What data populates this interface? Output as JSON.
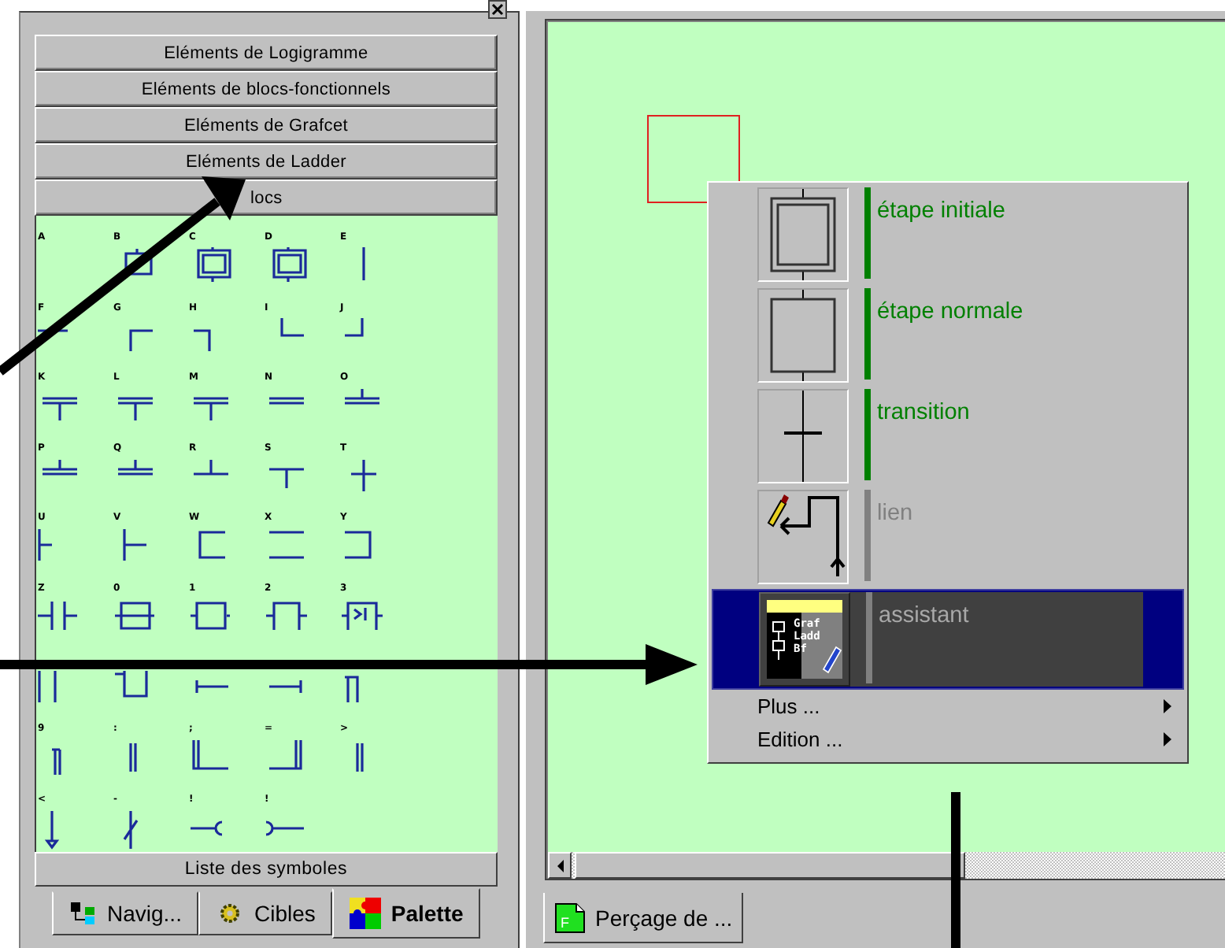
{
  "palette": {
    "category_buttons": [
      "Eléments de Logigramme",
      "Eléments de blocs-fonctionnels",
      "Eléments de Grafcet",
      "Eléments de Ladder",
      "locs"
    ],
    "symbols": [
      {
        "label": "A",
        "kind": "blank"
      },
      {
        "label": "B",
        "kind": "step"
      },
      {
        "label": "C",
        "kind": "initial-step"
      },
      {
        "label": "D",
        "kind": "initial-step"
      },
      {
        "label": "E",
        "kind": "vline"
      },
      {
        "label": "F",
        "kind": "hline"
      },
      {
        "label": "G",
        "kind": "corner-tl"
      },
      {
        "label": "H",
        "kind": "corner-tr"
      },
      {
        "label": "I",
        "kind": "corner-bl"
      },
      {
        "label": "J",
        "kind": "corner-br"
      },
      {
        "label": "K",
        "kind": "double-tee-down"
      },
      {
        "label": "L",
        "kind": "double-tee-down"
      },
      {
        "label": "M",
        "kind": "double-tee-down"
      },
      {
        "label": "N",
        "kind": "double-line"
      },
      {
        "label": "O",
        "kind": "double-tee-up"
      },
      {
        "label": "P",
        "kind": "double-tee-up"
      },
      {
        "label": "Q",
        "kind": "double-tee-up"
      },
      {
        "label": "R",
        "kind": "tee-up"
      },
      {
        "label": "S",
        "kind": "tee-down"
      },
      {
        "label": "T",
        "kind": "cross"
      },
      {
        "label": "U",
        "kind": "left-tee"
      },
      {
        "label": "V",
        "kind": "right-tee"
      },
      {
        "label": "W",
        "kind": "bracket-left"
      },
      {
        "label": "X",
        "kind": "two-lines"
      },
      {
        "label": "Y",
        "kind": "bracket-right"
      },
      {
        "label": "Z",
        "kind": "contact"
      },
      {
        "label": "0",
        "kind": "box-crossed"
      },
      {
        "label": "1",
        "kind": "box-dot"
      },
      {
        "label": "2",
        "kind": "box-open"
      },
      {
        "label": "3",
        "kind": "box-compare"
      },
      {
        "kind": "vlines"
      },
      {
        "kind": "cup"
      },
      {
        "kind": "line-stop-right"
      },
      {
        "kind": "line-stop-left"
      },
      {
        "kind": "hook"
      },
      {
        "label": "9",
        "kind": "hook-double"
      },
      {
        "label": ":",
        "kind": "double-vline"
      },
      {
        "label": ";",
        "kind": "double-corner-left"
      },
      {
        "label": "=",
        "kind": "double-corner-right"
      },
      {
        "label": ">",
        "kind": "double-vline"
      },
      {
        "label": "<",
        "kind": "down-arrow"
      },
      {
        "label": "-",
        "kind": "slash-contact"
      },
      {
        "label": "!",
        "kind": "plug"
      },
      {
        "label": "!",
        "kind": "socket"
      }
    ],
    "list_button": "Liste des symboles",
    "tabs": [
      {
        "label": "Navig...",
        "kind": "nodes",
        "selected": false
      },
      {
        "label": "Cibles",
        "kind": "gear",
        "selected": false
      },
      {
        "label": "Palette",
        "kind": "puzzle",
        "selected": true
      }
    ]
  },
  "editor": {
    "menu": {
      "items": [
        {
          "label": "étape initiale",
          "kind": "initial-step",
          "disabled": false,
          "selected": false
        },
        {
          "label": "étape normale",
          "kind": "step",
          "disabled": false,
          "selected": false
        },
        {
          "label": "transition",
          "kind": "transition",
          "disabled": false,
          "selected": false
        },
        {
          "label": "lien",
          "kind": "link",
          "disabled": true,
          "selected": false
        },
        {
          "label": "assistant",
          "kind": "assistant",
          "icon_lines": [
            "Graf",
            "Ladd",
            "Bf"
          ],
          "disabled": true,
          "selected": true
        }
      ],
      "submenus": [
        "Plus ...",
        "Edition ..."
      ]
    },
    "document_tab": {
      "label": "Perçage de ...",
      "icon_letter": "F"
    }
  }
}
